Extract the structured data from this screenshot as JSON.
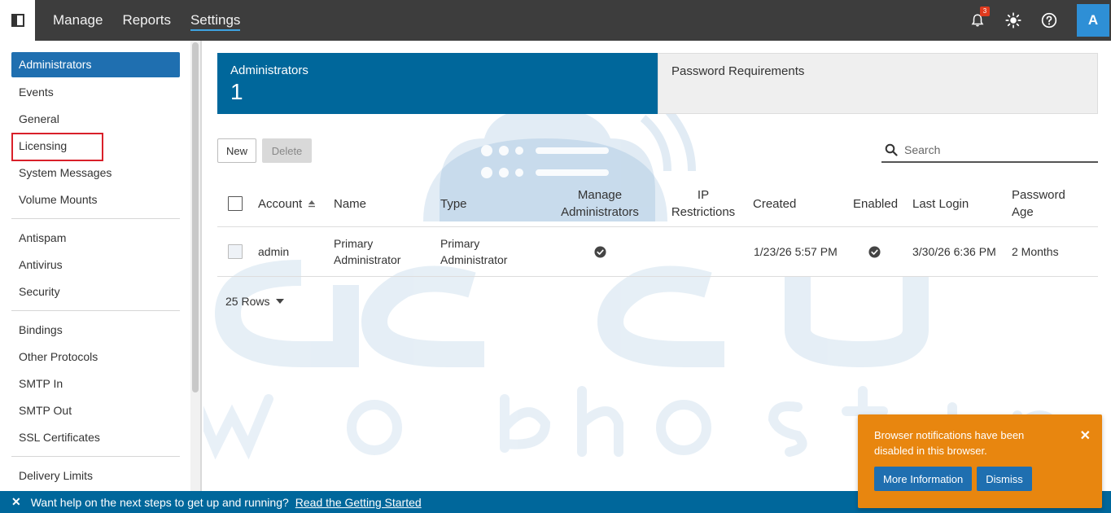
{
  "topbar": {
    "nav": [
      "Manage",
      "Reports",
      "Settings"
    ],
    "active_nav": "Settings",
    "notification_count": "3",
    "avatar_initial": "A",
    "colors": {
      "bar": "#3d3d3d",
      "accent": "#3ea2e0",
      "avatar": "#2e8fd6"
    }
  },
  "sidebar": {
    "active": "Administrators",
    "highlighted": "Licensing",
    "groups": [
      [
        "Administrators",
        "Events",
        "General",
        "Licensing",
        "System Messages",
        "Volume Mounts"
      ],
      [
        "Antispam",
        "Antivirus",
        "Security"
      ],
      [
        "Bindings",
        "Other Protocols",
        "SMTP In",
        "SMTP Out",
        "SSL Certificates"
      ],
      [
        "Delivery Limits"
      ]
    ]
  },
  "tabs": {
    "active": {
      "label": "Administrators",
      "count": "1"
    },
    "inactive": {
      "label": "Password Requirements"
    }
  },
  "toolbar": {
    "new_label": "New",
    "delete_label": "Delete",
    "search_placeholder": "Search"
  },
  "table": {
    "headers": {
      "account": "Account",
      "name": "Name",
      "type": "Type",
      "manage_admins": "Manage Administrators",
      "ip_restrictions": "IP Restrictions",
      "created": "Created",
      "enabled": "Enabled",
      "last_login": "Last Login",
      "password_age": "Password Age"
    },
    "rows": [
      {
        "account": "admin",
        "name": "Primary Administrator",
        "type": "Primary Administrator",
        "manage_admins": "check-icon",
        "ip_restrictions": "",
        "created": "1/23/26 5:57 PM",
        "enabled": "check-icon",
        "last_login": "3/30/26 6:36 PM",
        "password_age": "2 Months"
      }
    ],
    "rows_per_page": "25 Rows"
  },
  "bottombar": {
    "message": "Want help on the next steps to get up and running?",
    "link": "Read the Getting Started"
  },
  "toast": {
    "message": "Browser notifications have been disabled in this browser.",
    "more_info": "More Information",
    "dismiss": "Dismiss",
    "color": "#e8860f"
  },
  "watermark": {
    "line1": "accu",
    "line2": "web hosting"
  }
}
